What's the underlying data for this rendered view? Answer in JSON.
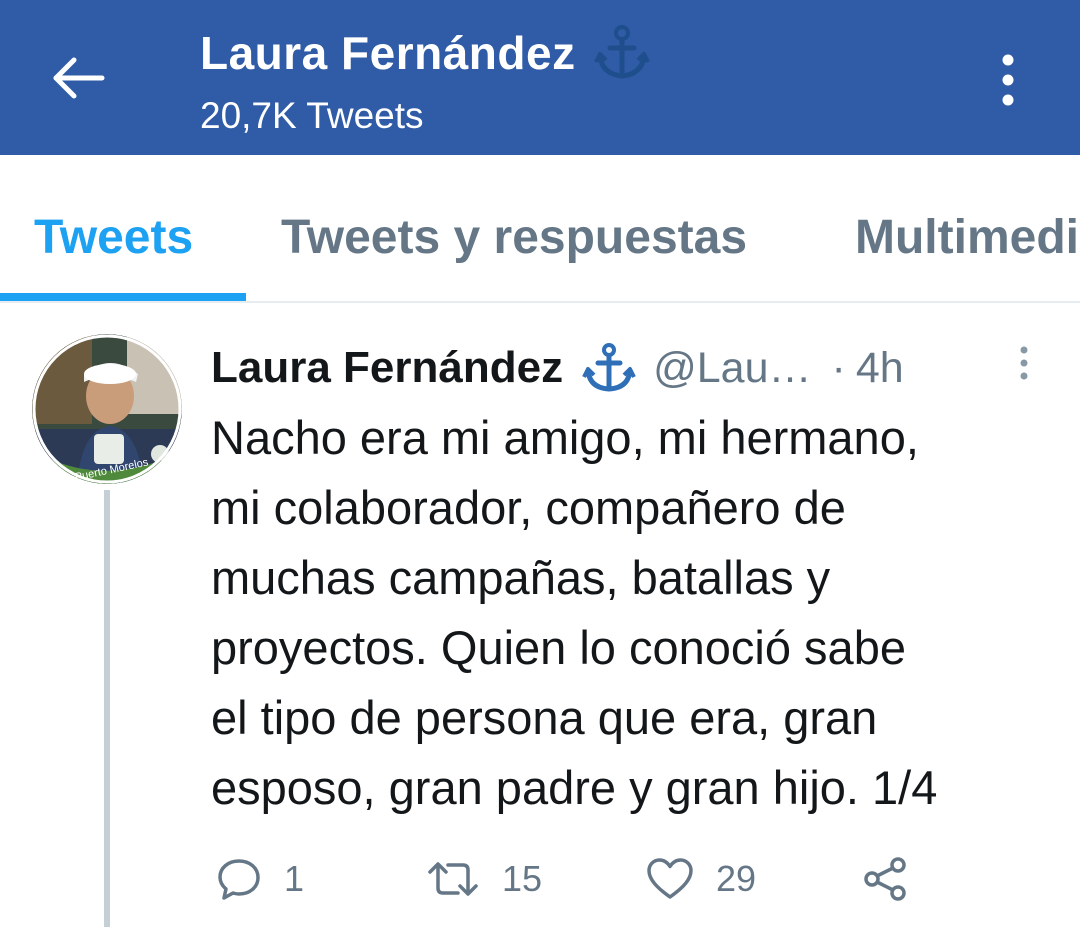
{
  "header": {
    "name": "Laura Fernández",
    "tweet_count": "20,7K Tweets",
    "name_icon": "anchor-icon",
    "back_icon": "back-arrow-icon",
    "menu_icon": "more-vertical-icon",
    "background": "#2f5ba7"
  },
  "tabs": [
    {
      "label": "Tweets",
      "active": true
    },
    {
      "label": "Tweets y respuestas",
      "active": false
    },
    {
      "label": "Multimedia",
      "active": false
    }
  ],
  "tweet": {
    "author_name": "Laura Fernández",
    "author_icon": "anchor-icon",
    "handle": "@Lau…",
    "separator": "·",
    "time": "4h",
    "avatar_badge_text": "Puerto Morelos",
    "text": "Nacho era mi amigo, mi hermano,\nmi colaborador, compañero de\nmuchas campañas, batallas y\nproyectos. Quien lo conoció sabe\nel tipo de persona que era, gran\nesposo, gran padre y gran hijo. 1/4",
    "actions": {
      "replies": "1",
      "retweets": "15",
      "likes": "29"
    }
  },
  "colors": {
    "accent": "#1da1f2",
    "secondary_text": "#657786",
    "primary_text": "#14171a"
  }
}
